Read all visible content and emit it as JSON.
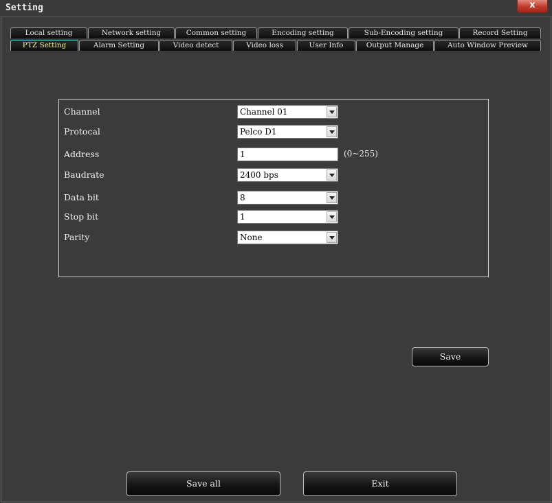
{
  "window": {
    "title": "Setting",
    "close_label": "x"
  },
  "tabs_row1": [
    {
      "label": "Local setting"
    },
    {
      "label": "Network setting"
    },
    {
      "label": "Common setting"
    },
    {
      "label": "Encoding setting"
    },
    {
      "label": "Sub-Encoding setting"
    },
    {
      "label": "Record Setting"
    }
  ],
  "tabs_row2": [
    {
      "label": "PTZ Setting",
      "active": true
    },
    {
      "label": "Alarm Setting"
    },
    {
      "label": "Video detect"
    },
    {
      "label": "Video loss"
    },
    {
      "label": "User Info"
    },
    {
      "label": "Output Manage"
    },
    {
      "label": "Auto Window Preview"
    }
  ],
  "form": {
    "channel": {
      "label": "Channel",
      "value": "Channel 01"
    },
    "protocol": {
      "label": "Protocal",
      "value": "Pelco D1"
    },
    "address": {
      "label": "Address",
      "value": "1",
      "hint": "(0~255)"
    },
    "baudrate": {
      "label": "Baudrate",
      "value": "2400 bps"
    },
    "databit": {
      "label": "Data bit",
      "value": "8"
    },
    "stopbit": {
      "label": "Stop bit",
      "value": "1"
    },
    "parity": {
      "label": "Parity",
      "value": "None"
    }
  },
  "buttons": {
    "save": "Save",
    "save_all": "Save all",
    "exit": "Exit"
  }
}
